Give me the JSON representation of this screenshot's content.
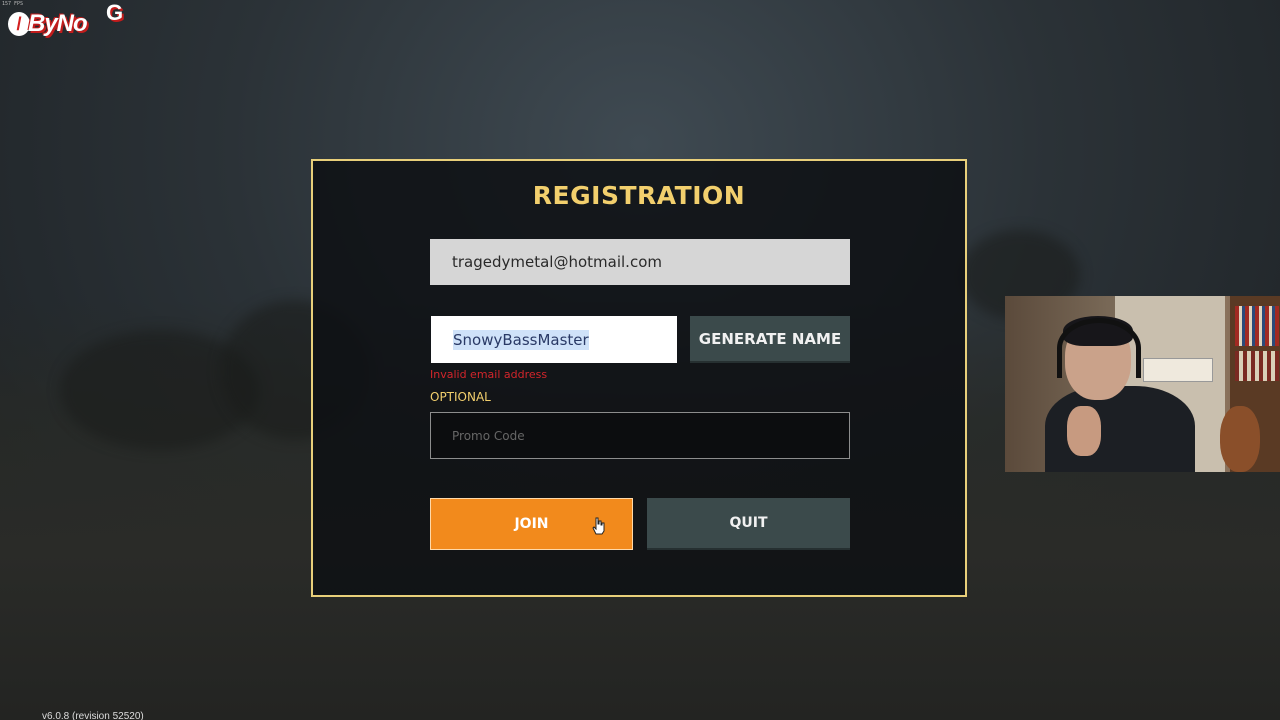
{
  "overlay": {
    "fps_text": "157 FPS",
    "logo": {
      "wordmark": "ByNo",
      "suffix": "G"
    },
    "version_text": "v6.0.8 (revision 52520)"
  },
  "registration": {
    "title": "REGISTRATION",
    "email": {
      "value": "tragedymetal@hotmail.com"
    },
    "nickname": {
      "value": "SnowyBassMaster",
      "selected": true
    },
    "generate_name_label": "GENERATE NAME",
    "error_text": "Invalid email address",
    "optional_label": "OPTIONAL",
    "promo": {
      "placeholder": "Promo Code",
      "value": ""
    },
    "join_label": "JOIN",
    "quit_label": "QUIT"
  },
  "colors": {
    "accent_gold": "#f2cf6d",
    "join_orange": "#f28a1c",
    "error_red": "#d3252b",
    "dark_button": "#3b4a4b",
    "panel_border": "#e8cf7a"
  },
  "icons": {
    "cursor": "hand-pointer-icon"
  }
}
